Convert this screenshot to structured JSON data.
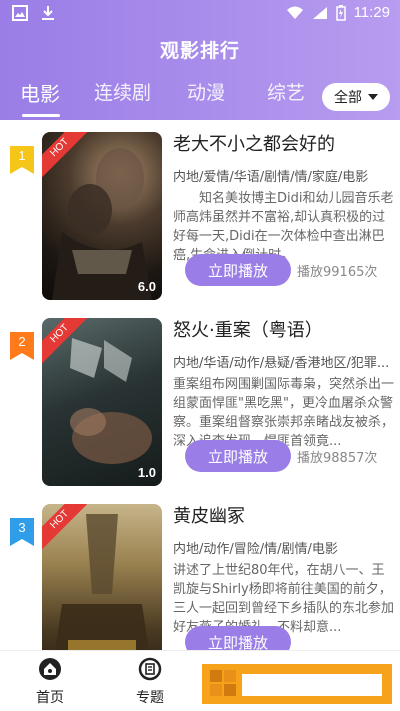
{
  "status_bar": {
    "time": "11:29"
  },
  "header": {
    "title": "观影排行"
  },
  "tabs": [
    {
      "label": "电影",
      "active": true
    },
    {
      "label": "连续剧",
      "active": false
    },
    {
      "label": "动漫",
      "active": false
    },
    {
      "label": "综艺",
      "active": false
    }
  ],
  "filter": {
    "label": "全部"
  },
  "items": [
    {
      "rank": "1",
      "rank_color": "#f5c518",
      "badge": "HOT",
      "score": "6.0",
      "title": "老大不小之都会好的",
      "tags": "内地/爱情/华语/剧情/情/家庭/电影",
      "description": "知名美妆博主Didi和幼儿园音乐老师高炜虽然并不富裕,却认真积极的过好每一天,Didi在一次体检中查出淋巴癌,生命进入倒计时。",
      "play_label": "立即播放",
      "plays": "播放99165次"
    },
    {
      "rank": "2",
      "rank_color": "#ff7a1a",
      "badge": "HOT",
      "score": "1.0",
      "title": "怒火·重案（粤语）",
      "tags": "内地/华语/动作/悬疑/香港地区/犯罪...",
      "description": "重案组布网围剿国际毒枭，突然杀出一组蒙面悍匪\"黑吃黑\"，更冷血屠杀众警察。重案组督察张崇邦亲睹战友被杀，深入追查发现，悍匪首领竟...",
      "play_label": "立即播放",
      "plays": "播放98857次"
    },
    {
      "rank": "3",
      "rank_color": "#2f9de8",
      "badge": "HOT",
      "score": "",
      "title": "黄皮幽冢",
      "tags": "内地/动作/冒险/情/剧情/电影",
      "description": "讲述了上世纪80年代，在胡八一、王凯旋与Shirly杨即将前往美国的前夕，三人一起回到曾经下乡插队的东北参加好友燕子的婚礼。不料却意...",
      "play_label": "立即播放",
      "plays": ""
    }
  ],
  "bottom_nav": [
    {
      "label": "首页",
      "icon": "home-icon"
    },
    {
      "label": "专题",
      "icon": "topic-icon"
    }
  ]
}
